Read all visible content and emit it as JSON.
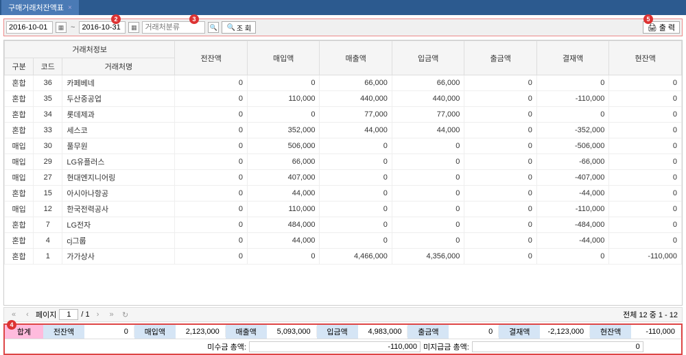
{
  "tab": {
    "title": "구매거래처잔액표"
  },
  "toolbar": {
    "date_from": "2016-10-01",
    "date_to": "2016-10-31",
    "search_placeholder": "거래처분류",
    "query_label": "조 회",
    "print_label": "출 력"
  },
  "badges": {
    "b2": "2",
    "b3": "3",
    "b4": "4",
    "b5": "5"
  },
  "headers": {
    "group": "거래처정보",
    "gubun": "구분",
    "code": "코드",
    "name": "거래처명",
    "prev": "전잔액",
    "purchase": "매입액",
    "sale": "매출액",
    "deposit": "입금액",
    "withdraw": "출금액",
    "balance": "결재액",
    "current": "현잔액"
  },
  "rows": [
    {
      "g": "혼합",
      "c": "36",
      "n": "카페베네",
      "p": "0",
      "pu": "0",
      "s": "66,000",
      "d": "66,000",
      "w": "0",
      "b": "0",
      "cu": "0"
    },
    {
      "g": "혼합",
      "c": "35",
      "n": "두산중공업",
      "p": "0",
      "pu": "110,000",
      "s": "440,000",
      "d": "440,000",
      "w": "0",
      "b": "-110,000",
      "cu": "0"
    },
    {
      "g": "혼합",
      "c": "34",
      "n": "롯데제과",
      "p": "0",
      "pu": "0",
      "s": "77,000",
      "d": "77,000",
      "w": "0",
      "b": "0",
      "cu": "0"
    },
    {
      "g": "혼합",
      "c": "33",
      "n": "세스코",
      "p": "0",
      "pu": "352,000",
      "s": "44,000",
      "d": "44,000",
      "w": "0",
      "b": "-352,000",
      "cu": "0"
    },
    {
      "g": "매입",
      "c": "30",
      "n": "풀무원",
      "p": "0",
      "pu": "506,000",
      "s": "0",
      "d": "0",
      "w": "0",
      "b": "-506,000",
      "cu": "0"
    },
    {
      "g": "매입",
      "c": "29",
      "n": "LG유플러스",
      "p": "0",
      "pu": "66,000",
      "s": "0",
      "d": "0",
      "w": "0",
      "b": "-66,000",
      "cu": "0"
    },
    {
      "g": "매입",
      "c": "27",
      "n": "현대엔지니어링",
      "p": "0",
      "pu": "407,000",
      "s": "0",
      "d": "0",
      "w": "0",
      "b": "-407,000",
      "cu": "0"
    },
    {
      "g": "혼합",
      "c": "15",
      "n": "아시아나항공",
      "p": "0",
      "pu": "44,000",
      "s": "0",
      "d": "0",
      "w": "0",
      "b": "-44,000",
      "cu": "0"
    },
    {
      "g": "매입",
      "c": "12",
      "n": "한국전력공사",
      "p": "0",
      "pu": "110,000",
      "s": "0",
      "d": "0",
      "w": "0",
      "b": "-110,000",
      "cu": "0"
    },
    {
      "g": "혼합",
      "c": "7",
      "n": "LG전자",
      "p": "0",
      "pu": "484,000",
      "s": "0",
      "d": "0",
      "w": "0",
      "b": "-484,000",
      "cu": "0"
    },
    {
      "g": "혼합",
      "c": "4",
      "n": "cj그룹",
      "p": "0",
      "pu": "44,000",
      "s": "0",
      "d": "0",
      "w": "0",
      "b": "-44,000",
      "cu": "0"
    },
    {
      "g": "혼합",
      "c": "1",
      "n": "가가상사",
      "p": "0",
      "pu": "0",
      "s": "4,466,000",
      "d": "4,356,000",
      "w": "0",
      "b": "0",
      "cu": "-110,000"
    }
  ],
  "pager": {
    "page_label": "페이지",
    "page": "1",
    "total": "/ 1",
    "count": "전체 12 중 1 - 12"
  },
  "summary": {
    "total_label": "합계",
    "prev_l": "전잔액",
    "prev_v": "0",
    "pu_l": "매입액",
    "pu_v": "2,123,000",
    "s_l": "매출액",
    "s_v": "5,093,000",
    "d_l": "입금액",
    "d_v": "4,983,000",
    "w_l": "출금액",
    "w_v": "0",
    "b_l": "결재액",
    "b_v": "-2,123,000",
    "c_l": "현잔액",
    "c_v": "-110,000",
    "receivable_l": "미수금 총액:",
    "receivable_v": "-110,000",
    "payable_l": "미지급금 총액:",
    "payable_v": "0"
  }
}
